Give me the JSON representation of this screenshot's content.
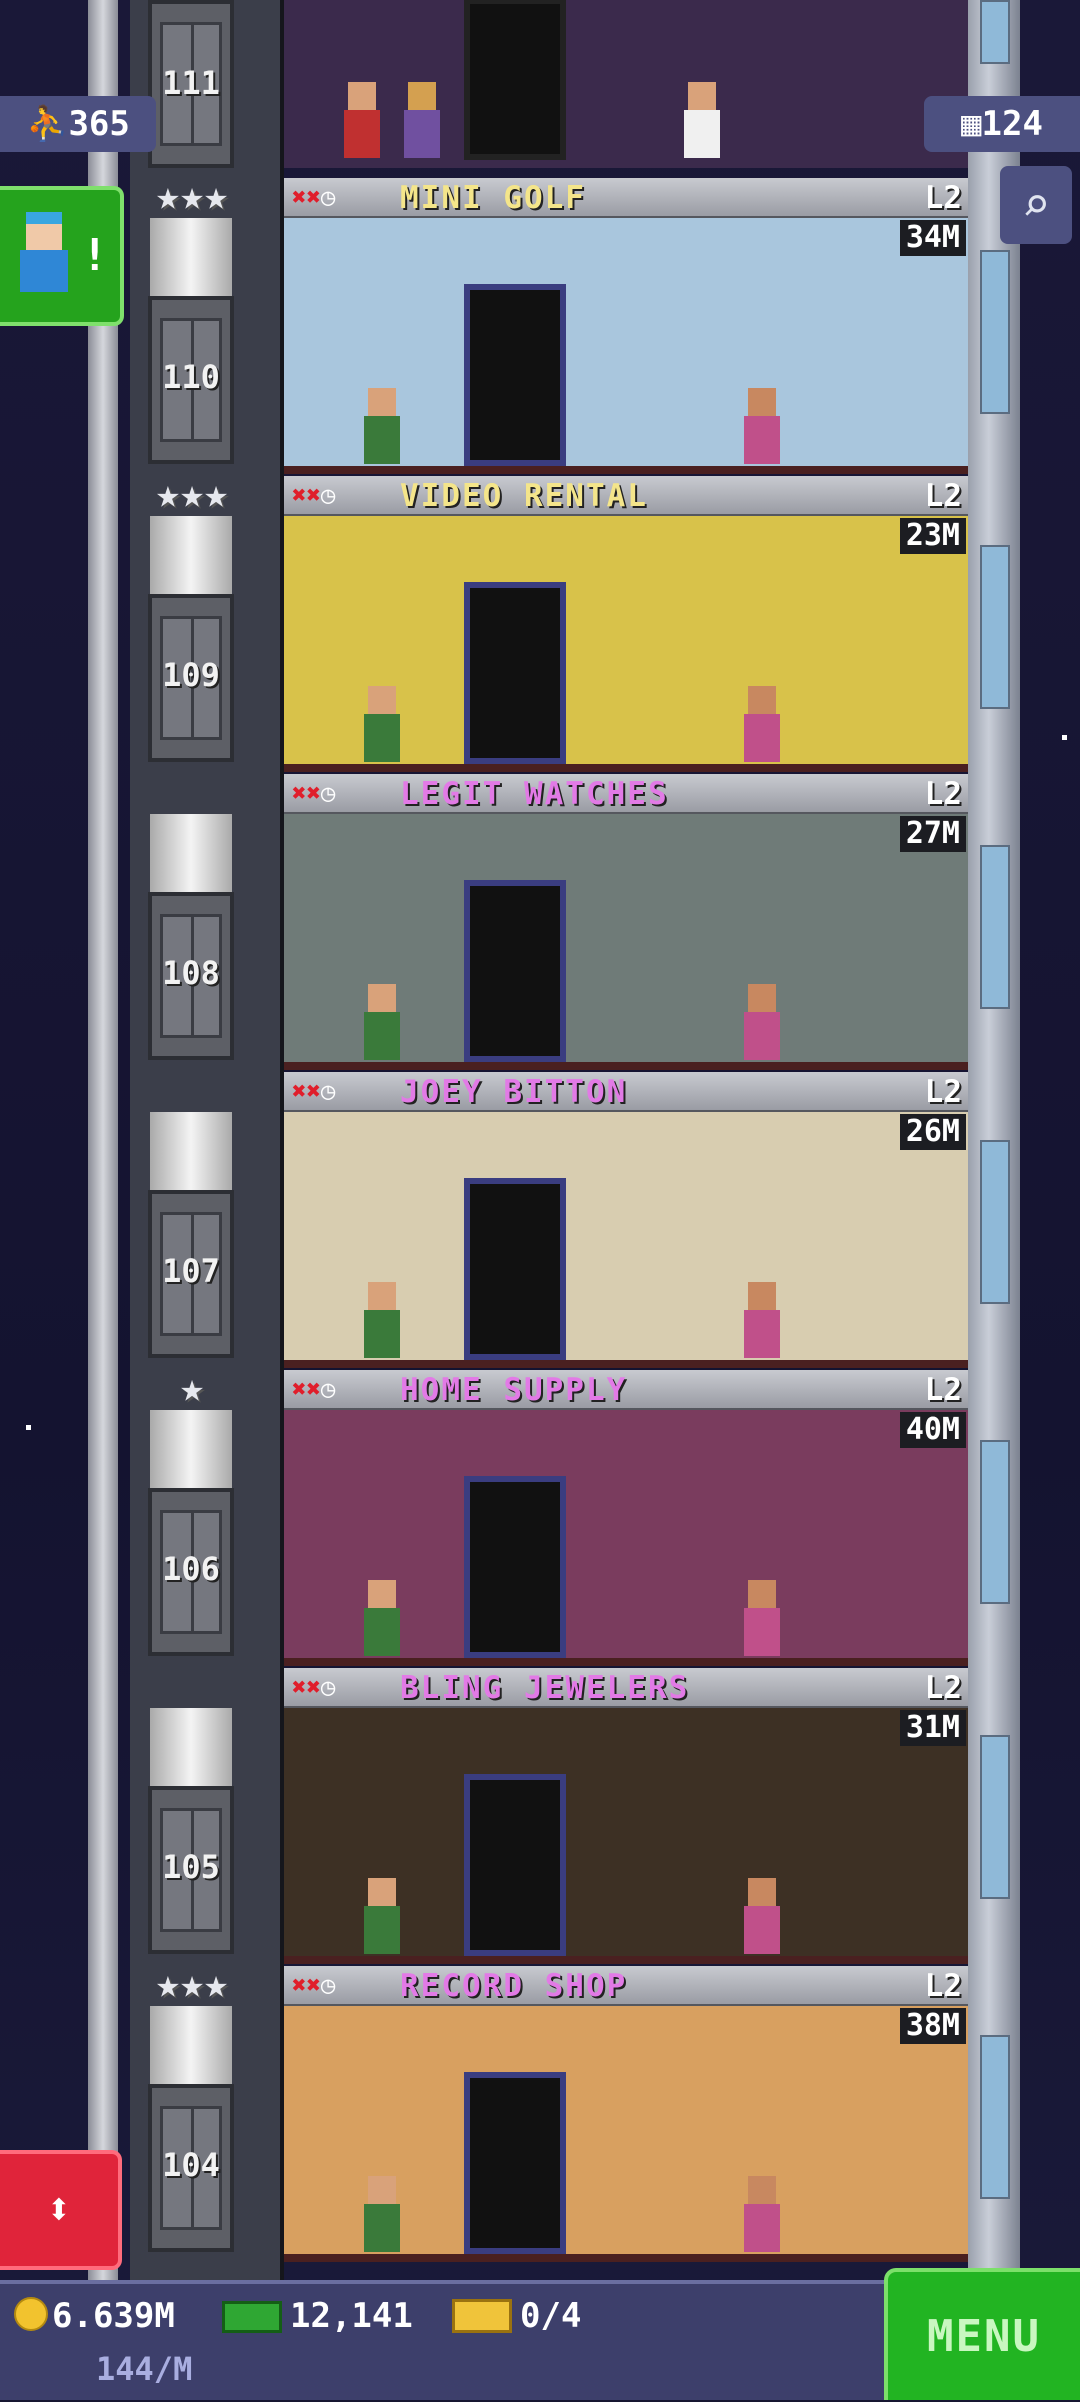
{
  "hud": {
    "population": "365",
    "floors_count": "124",
    "coins": "6.639M",
    "rate": "144/M",
    "bux": "12,141",
    "tickets": "0/4",
    "menu_label": "MENU"
  },
  "top_floor": {
    "number": "111"
  },
  "floors": [
    {
      "number": "110",
      "name": "MINI GOLF",
      "level": "L2",
      "price": "34M",
      "name_color": "#f4e58a",
      "room_color": "#a9c6dd",
      "stars": "★★★"
    },
    {
      "number": "109",
      "name": "VIDEO RENTAL",
      "level": "L2",
      "price": "23M",
      "name_color": "#f4e58a",
      "room_color": "#d8c24a",
      "stars": "★★★"
    },
    {
      "number": "108",
      "name": "LEGIT WATCHES",
      "level": "L2",
      "price": "27M",
      "name_color": "#e27ae6",
      "room_color": "#6f7b78",
      "stars": ""
    },
    {
      "number": "107",
      "name": "JOEY BITTON",
      "level": "L2",
      "price": "26M",
      "name_color": "#e27ae6",
      "room_color": "#d8cdb0",
      "stars": ""
    },
    {
      "number": "106",
      "name": "HOME SUPPLY",
      "level": "L2",
      "price": "40M",
      "name_color": "#e27ae6",
      "room_color": "#7a3c5e",
      "stars": "★"
    },
    {
      "number": "105",
      "name": "BLING JEWELERS",
      "level": "L2",
      "price": "31M",
      "name_color": "#e27ae6",
      "room_color": "#3d3024",
      "stars": ""
    },
    {
      "number": "104",
      "name": "RECORD SHOP",
      "level": "L2",
      "price": "38M",
      "name_color": "#e27ae6",
      "room_color": "#d8a060",
      "stars": "★★★"
    }
  ],
  "colors": {
    "elevator_button": "#e0243a",
    "menu_button": "#22b422",
    "vip_button": "#25a31d"
  }
}
